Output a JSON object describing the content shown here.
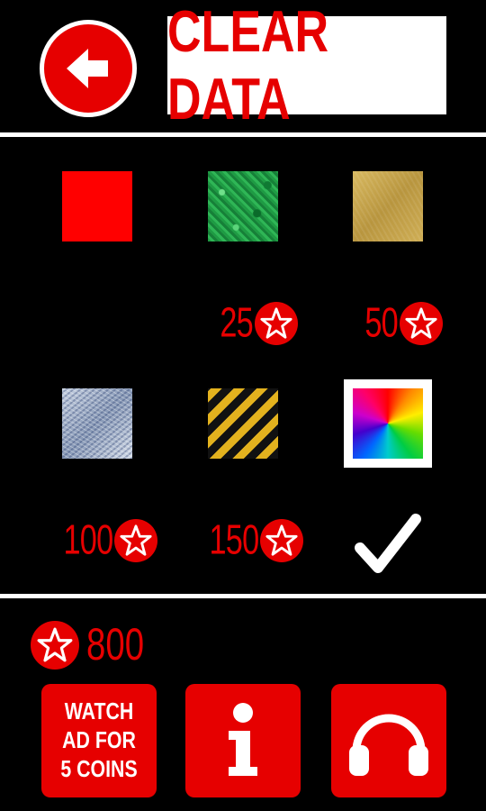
{
  "header": {
    "back_icon": "arrow-left-icon",
    "clear_label": "CLEAR DATA"
  },
  "shop": {
    "items": [
      {
        "name": "red",
        "price": ""
      },
      {
        "name": "green",
        "price": "25"
      },
      {
        "name": "gold",
        "price": "50"
      },
      {
        "name": "silver",
        "price": "100"
      },
      {
        "name": "hazard",
        "price": "150"
      },
      {
        "name": "rainbow",
        "price": "",
        "selected": true
      }
    ],
    "coin_icon": "star-coin-icon",
    "selected_icon": "checkmark-icon"
  },
  "footer": {
    "coins": "800",
    "watch_ad_label": "WATCH\nAD FOR\n5 COINS",
    "info_icon": "info-icon",
    "audio_icon": "headphones-icon"
  },
  "colors": {
    "accent": "#e60000",
    "background": "#000000",
    "divider": "#ffffff"
  }
}
